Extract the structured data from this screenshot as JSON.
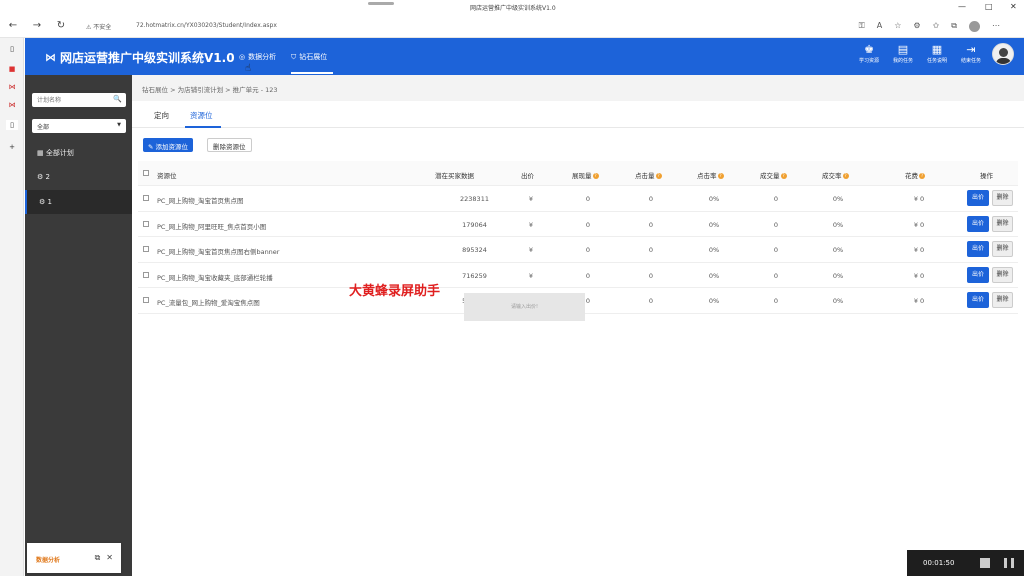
{
  "browser": {
    "window_title": "网店运营推广中级实训系统V1.0",
    "security_label": "不安全",
    "url": "72.hotmatrix.cn/YX030203/Student/Index.aspx",
    "win_min": "—",
    "win_max": "□",
    "win_close": "✕"
  },
  "header": {
    "logo_mark": "⋈",
    "title": "网店运营推广中级实训系统V1.0",
    "nav": [
      {
        "label": "数据分析",
        "icon": "◎"
      },
      {
        "label": "钻石展位",
        "icon": "⛉"
      }
    ],
    "right_items": [
      {
        "label": "学习资源",
        "icon": "♚"
      },
      {
        "label": "我的任务",
        "icon": "▤"
      },
      {
        "label": "任务说明",
        "icon": "▦"
      },
      {
        "label": "结束任务",
        "icon": "⇥"
      }
    ]
  },
  "sidebar": {
    "search_placeholder": "计划名称",
    "search_icon": "🔍",
    "select_value": "全部",
    "items": [
      {
        "label": "全部计划",
        "icon": "▦"
      },
      {
        "label": "2",
        "icon": "⚙"
      },
      {
        "label": "1",
        "icon": "⚙"
      }
    ]
  },
  "bottom_popup": {
    "title": "数据分析",
    "restore_icon": "⧉",
    "close_icon": "✕"
  },
  "breadcrumb": "钻石展位 > 为店铺引流计划 > 推广单元 - 123",
  "tabs": [
    "定向",
    "资源位"
  ],
  "buttons": {
    "add": "添加资源位",
    "delete": "删除资源位"
  },
  "table": {
    "headers": [
      "资源位",
      "潜在买家数据",
      "出价",
      "展现量",
      "点击量",
      "点击率",
      "成交量",
      "成交率",
      "花费",
      "操作"
    ],
    "rows": [
      {
        "name": "PC_网上购物_淘宝首页焦点图",
        "buyers": "2238311",
        "bid": "¥",
        "impr": "0",
        "clicks": "0",
        "ctr": "0%",
        "orders": "0",
        "cvr": "0%",
        "cost": "¥ 0"
      },
      {
        "name": "PC_网上购物_阿里旺旺_焦点首页小图",
        "buyers": "179064",
        "bid": "¥",
        "impr": "0",
        "clicks": "0",
        "ctr": "0%",
        "orders": "0",
        "cvr": "0%",
        "cost": "¥ 0"
      },
      {
        "name": "PC_网上购物_淘宝首页焦点图右侧banner",
        "buyers": "895324",
        "bid": "¥",
        "impr": "0",
        "clicks": "0",
        "ctr": "0%",
        "orders": "0",
        "cvr": "0%",
        "cost": "¥ 0"
      },
      {
        "name": "PC_网上购物_淘宝收藏夹_底部通栏轮播",
        "buyers": "716259",
        "bid": "¥",
        "impr": "0",
        "clicks": "0",
        "ctr": "0%",
        "orders": "0",
        "cvr": "0%",
        "cost": "¥ 0"
      },
      {
        "name": "PC_流量包_网上购物_爱淘宝焦点图",
        "buyers": "537194",
        "bid": "¥",
        "impr": "0",
        "clicks": "0",
        "ctr": "0%",
        "orders": "0",
        "cvr": "0%",
        "cost": "¥ 0"
      }
    ],
    "bid_button": "出价",
    "delete_button": "删除"
  },
  "watermark": "大黄蜂录屏助手",
  "toast": "请输入出价!",
  "recorder": {
    "time": "00:01:50"
  },
  "colors": {
    "primary": "#1d63d9",
    "sidebar": "#3a3a3a",
    "accent": "#f0a030"
  }
}
